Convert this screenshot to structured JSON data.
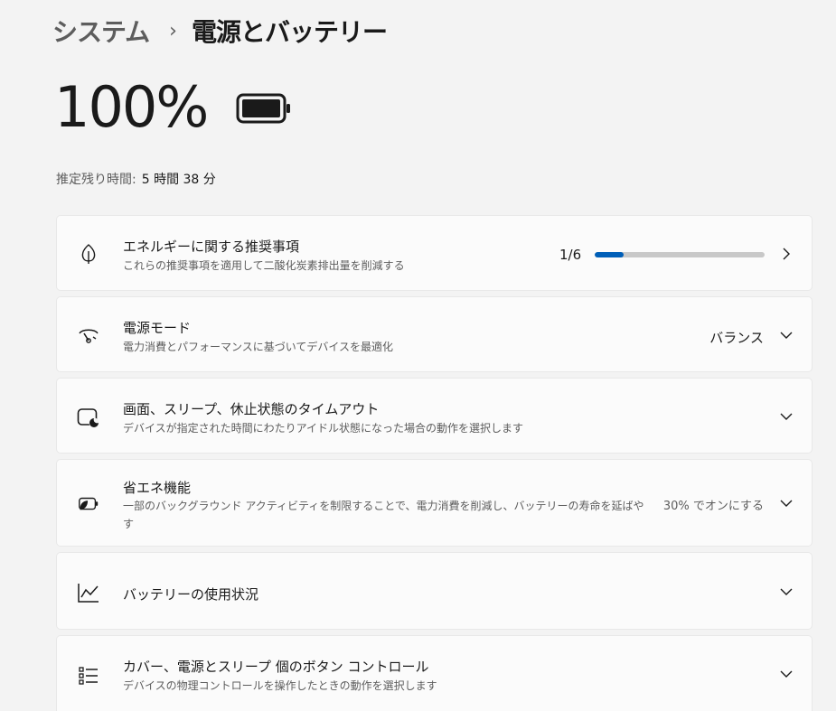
{
  "breadcrumb": {
    "parent": "システム",
    "separator": "›",
    "current": "電源とバッテリー"
  },
  "battery": {
    "percent": "100%",
    "remaining_label": "推定残り時間:",
    "remaining_value": "5 時間 38 分"
  },
  "cards": {
    "energy": {
      "icon": "leaf-icon",
      "title": "エネルギーに関する推奨事項",
      "desc": "これらの推奨事項を適用して二酸化炭素排出量を削減する",
      "count": "1/6",
      "progress": 0.17
    },
    "power_mode": {
      "icon": "power-mode-gauge-icon",
      "title": "電源モード",
      "desc": "電力消費とパフォーマンスに基づいてデバイスを最適化",
      "value": "バランス"
    },
    "timeout": {
      "icon": "screen-sleep-icon",
      "title": "画面、スリープ、休止状態のタイムアウト",
      "desc": "デバイスが指定された時間にわたりアイドル状態になった場合の動作を選択します"
    },
    "saver": {
      "icon": "battery-saver-icon",
      "title": "省エネ機能",
      "desc_line1": "一部のバックグラウンド アクティビティを制限することで、電力消費を削減し、バッテリーの寿命を延ばや",
      "desc_line2": "す",
      "value": "30% でオンにする"
    },
    "usage": {
      "icon": "line-chart-icon",
      "title": "バッテリーの使用状況"
    },
    "buttons": {
      "icon": "list-icon",
      "title": "カバー、電源とスリープ 個のボタン コントロール",
      "desc": "デバイスの物理コントロールを操作したときの動作を選択します"
    }
  },
  "colors": {
    "accent": "#005fb8",
    "background": "#f3f3f3",
    "card": "#fbfbfb"
  }
}
